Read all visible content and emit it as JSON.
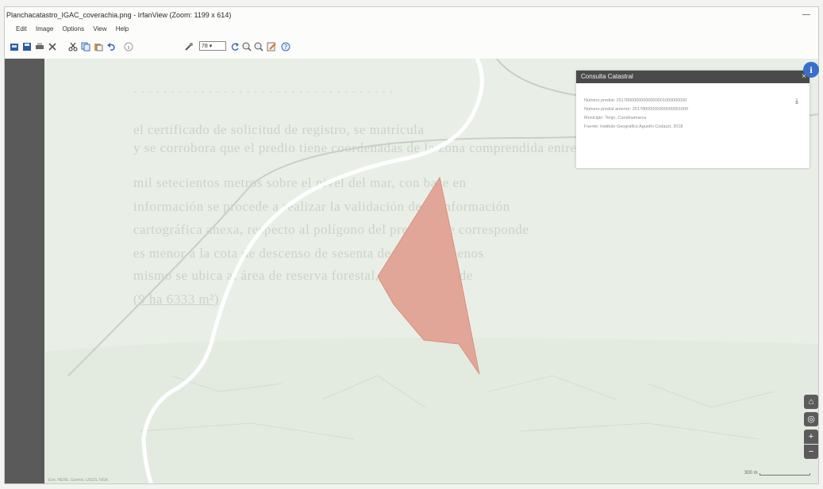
{
  "window": {
    "title": "Planchacatastro_IGAC_coverachia.png - IrfanView (Zoom: 1199 x 614)",
    "minimize_glyph": "—"
  },
  "menu": [
    "Edit",
    "Image",
    "Options",
    "View",
    "Help"
  ],
  "toolbar": {
    "zoom_value": "78 ▾",
    "icons": [
      "open-icon",
      "save-icon",
      "print-icon",
      "delete-icon",
      "cut-icon",
      "copy-icon",
      "paste-icon",
      "undo-icon",
      "info-icon",
      "settings-icon",
      "zoom-select",
      "rotate-left-icon",
      "zoom-in-icon",
      "zoom-out-icon",
      "edit-icon",
      "help-icon"
    ]
  },
  "map": {
    "background_text": [
      "el certificado de solicitud de registro, se matrícula",
      "y se corrobora que el predio tiene coordenadas de la zona comprendida entre la cota",
      "mil setecientos metros sobre el nivel del mar, con base en",
      "información se procede a realizar la validación de la información",
      "cartográfica anexa, respecto al polígono del predio, que corresponde",
      "es menor a la cota de descenso de sesenta de altitud o menos",
      "mismo se ubica al área de reserva forestal, con una área de",
      "(9 ha 6333 m²)"
    ],
    "parcel_color": "#e2a699",
    "road_color": "#ffffff"
  },
  "popup": {
    "title": "Consulta Catastral",
    "close_glyph": "×",
    "lines": [
      "Número predial: 25178000000000000001000000000",
      "Número predial anterior: 25178000000000000001000",
      "Municipio: Tenjo, Cundinamarca",
      "Fuente: Instituto Geográfico Agustín Codazzi, 2018"
    ],
    "download_glyph": "⤓"
  },
  "controls": {
    "info_glyph": "i",
    "home_glyph": "⌂",
    "locate_glyph": "◎",
    "zoom_in_glyph": "+",
    "zoom_out_glyph": "−"
  },
  "scale_label": "300 m",
  "attribution": "Esri, HERE, Garmin, USGS, NGA"
}
